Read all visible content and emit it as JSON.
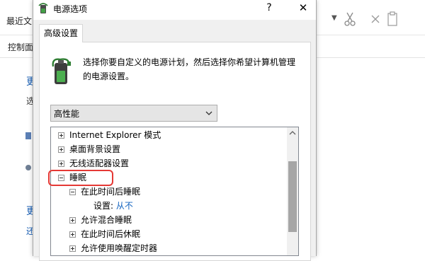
{
  "background": {
    "recent_label": "最近文",
    "control_label": "控制面",
    "link_chars": [
      "更",
      "选",
      "更",
      "还"
    ]
  },
  "dialog": {
    "title": "电源选项",
    "help_label": "?",
    "close_label": "✕",
    "tab_label": "高级设置",
    "description": "选择你要自定义的电源计划，然后选择你希望计算机管理的电源设置。",
    "plan_select": {
      "value": "高性能"
    },
    "tree": [
      {
        "label": "Internet Explorer 模式",
        "expanded": false
      },
      {
        "label": "桌面背景设置",
        "expanded": false
      },
      {
        "label": "无线适配器设置",
        "expanded": false
      },
      {
        "label": "睡眠",
        "expanded": true,
        "highlighted": true
      },
      {
        "label": "在此时间后睡眠",
        "expanded": true
      },
      {
        "setting_label": "设置:",
        "setting_value": "从不"
      },
      {
        "label": "允许混合睡眠",
        "expanded": false
      },
      {
        "label": "在此时间后休眠",
        "expanded": false
      },
      {
        "label": "允许使用唤醒定时器",
        "expanded": false
      }
    ]
  },
  "colors": {
    "highlight_border": "#e53935",
    "setting_value": "#1565c0",
    "link": "#1a5fb4"
  },
  "icons": [
    "power-options-icon",
    "battery-plug-icon",
    "scissors-icon",
    "cut-x-icon",
    "paste-icon",
    "help-icon",
    "close-icon",
    "dropdown-arrow-icon",
    "scroll-up-arrow-icon"
  ]
}
